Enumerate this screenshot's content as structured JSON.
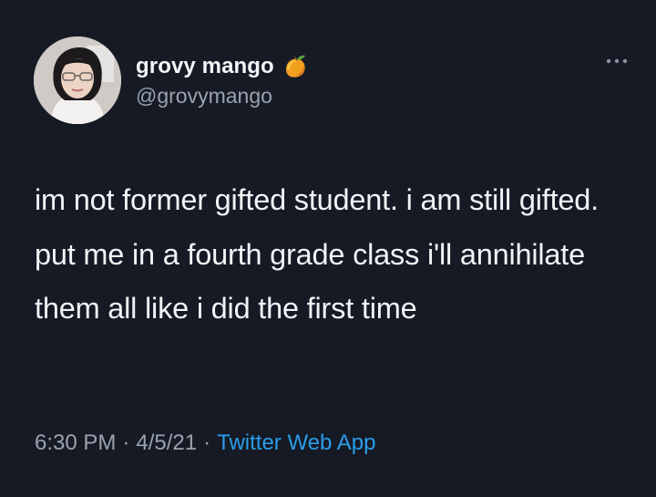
{
  "user": {
    "display_name": "grovy mango",
    "handle": "@grovymango",
    "badge_icon": "mango-icon",
    "avatar_icon": "profile-photo"
  },
  "tweet": {
    "text": "im not former gifted student. i am still gifted. put me in a fourth grade class i'll annihilate them all like i did the first time"
  },
  "meta": {
    "time": "6:30 PM",
    "date": "4/5/21",
    "source": "Twitter Web App",
    "separator": "·"
  },
  "menu": {
    "icon": "more-icon"
  },
  "colors": {
    "background": "#151a25",
    "text": "#f1f3f5",
    "muted": "#9aa3ad",
    "link": "#2b9ce8"
  }
}
